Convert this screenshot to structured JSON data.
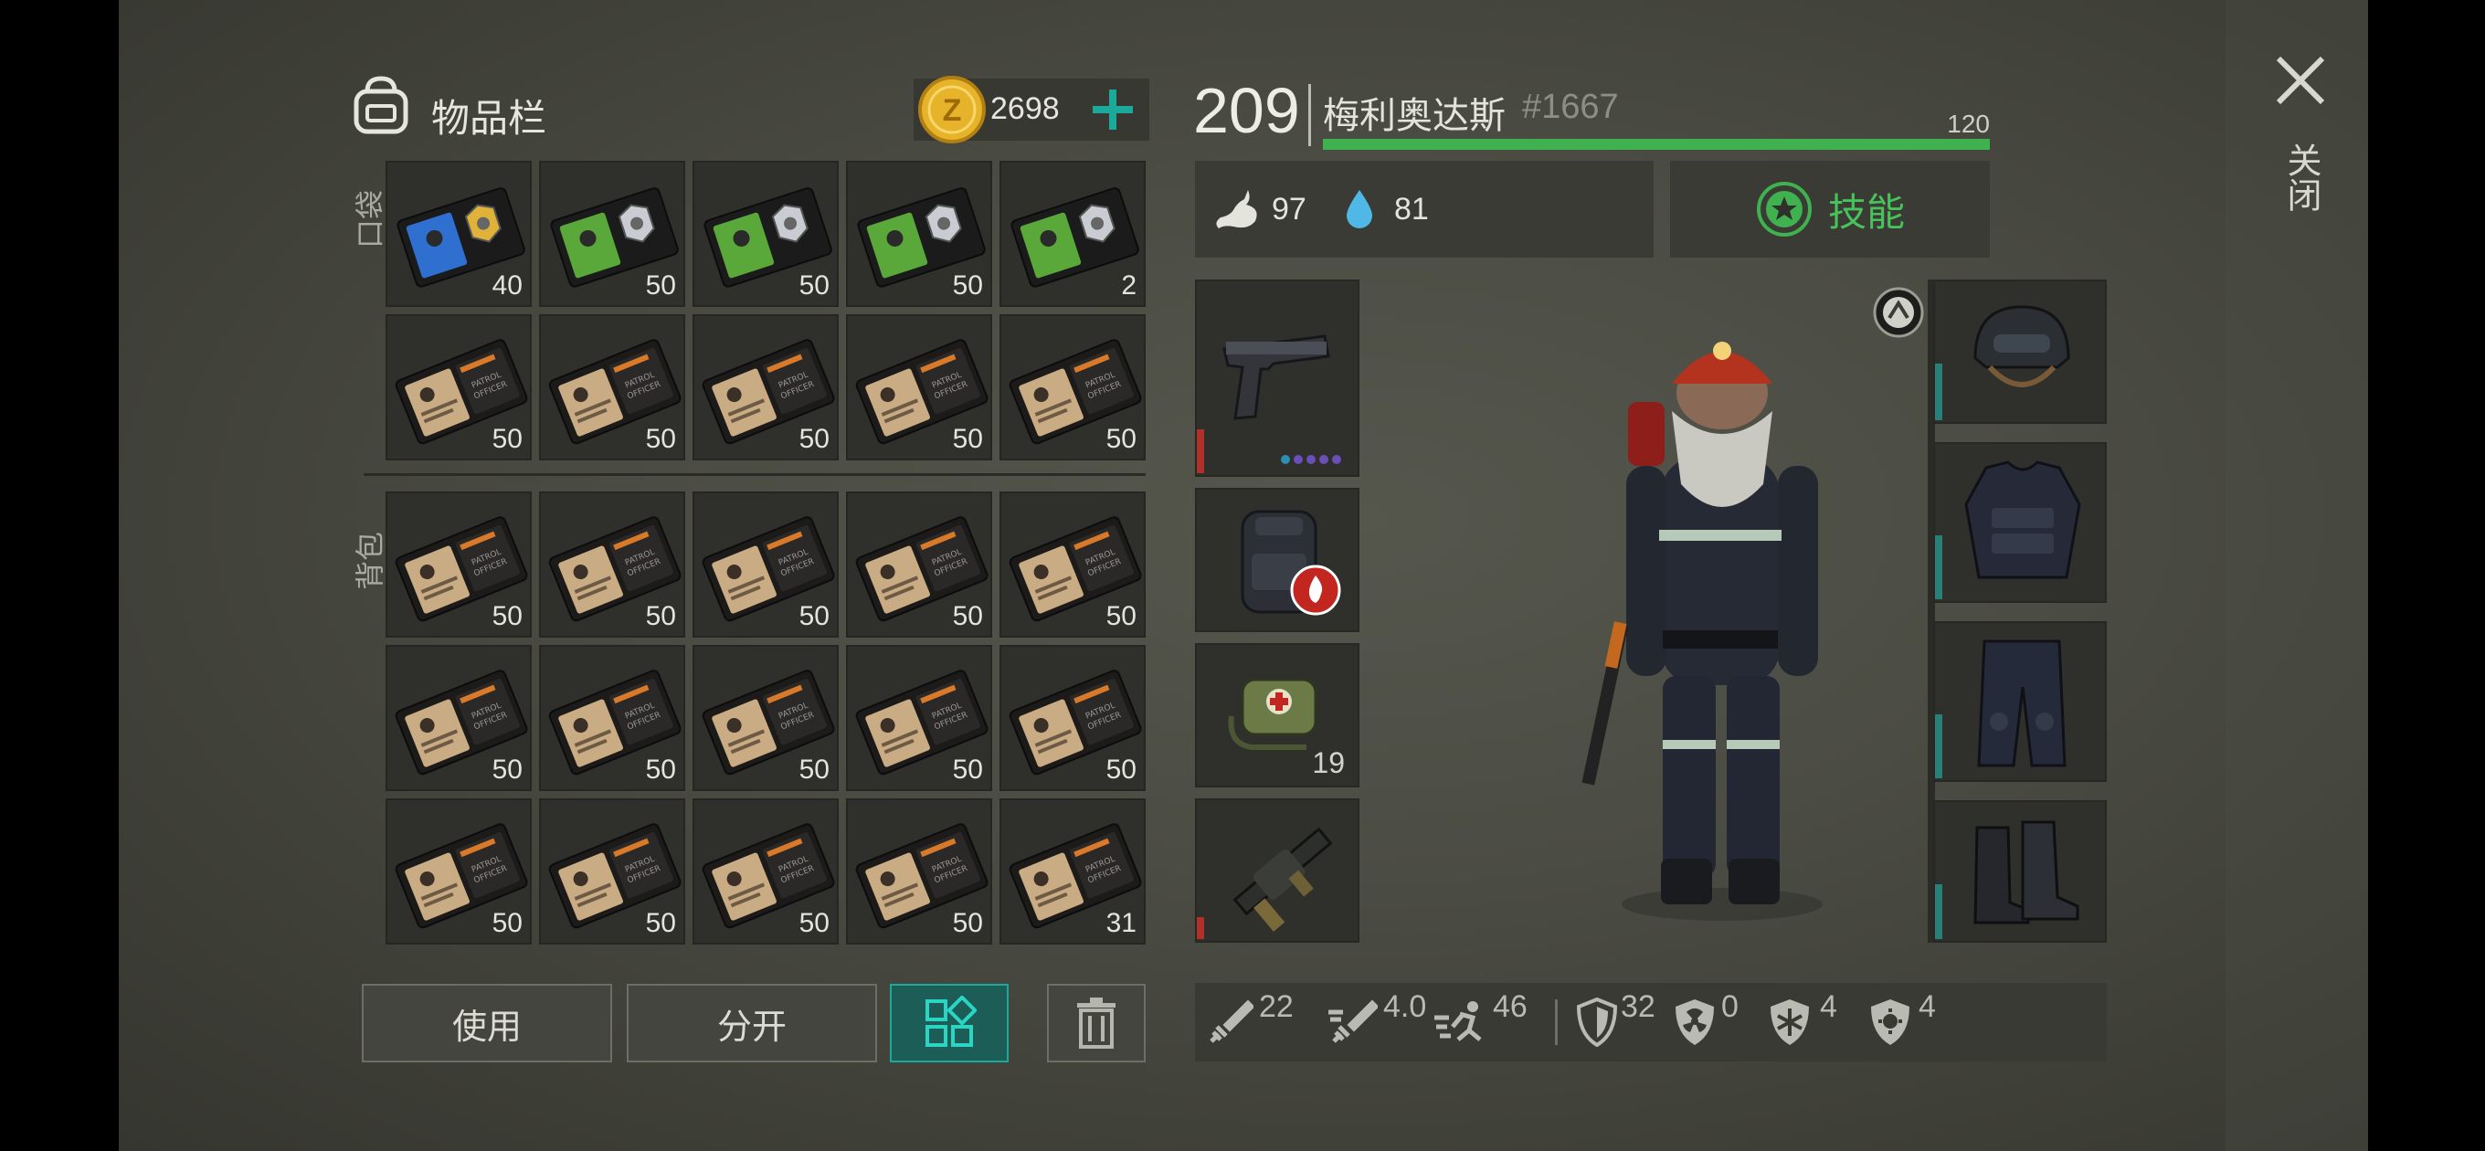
{
  "inventory": {
    "title": "物品栏",
    "coins": "2698",
    "pocket_label": "口袋",
    "backpack_label": "背包",
    "pocket_items": [
      {
        "icon": "police-badge-wallet-blue-icon",
        "count": "40"
      },
      {
        "icon": "police-badge-wallet-green-icon",
        "count": "50"
      },
      {
        "icon": "police-badge-wallet-green-icon",
        "count": "50"
      },
      {
        "icon": "police-badge-wallet-green-icon",
        "count": "50"
      },
      {
        "icon": "police-badge-wallet-green-icon",
        "count": "2"
      },
      {
        "icon": "patrol-officer-id-icon",
        "count": "50"
      },
      {
        "icon": "patrol-officer-id-icon",
        "count": "50"
      },
      {
        "icon": "patrol-officer-id-icon",
        "count": "50"
      },
      {
        "icon": "patrol-officer-id-icon",
        "count": "50"
      },
      {
        "icon": "patrol-officer-id-icon",
        "count": "50"
      }
    ],
    "backpack_items": [
      {
        "icon": "patrol-officer-id-icon",
        "count": "50"
      },
      {
        "icon": "patrol-officer-id-icon",
        "count": "50"
      },
      {
        "icon": "patrol-officer-id-icon",
        "count": "50"
      },
      {
        "icon": "patrol-officer-id-icon",
        "count": "50"
      },
      {
        "icon": "patrol-officer-id-icon",
        "count": "50"
      },
      {
        "icon": "patrol-officer-id-icon",
        "count": "50"
      },
      {
        "icon": "patrol-officer-id-icon",
        "count": "50"
      },
      {
        "icon": "patrol-officer-id-icon",
        "count": "50"
      },
      {
        "icon": "patrol-officer-id-icon",
        "count": "50"
      },
      {
        "icon": "patrol-officer-id-icon",
        "count": "50"
      },
      {
        "icon": "patrol-officer-id-icon",
        "count": "50"
      },
      {
        "icon": "patrol-officer-id-icon",
        "count": "50"
      },
      {
        "icon": "patrol-officer-id-icon",
        "count": "50"
      },
      {
        "icon": "patrol-officer-id-icon",
        "count": "50"
      },
      {
        "icon": "patrol-officer-id-icon",
        "count": "31"
      }
    ],
    "patrol_text": "PATROL OFFICER"
  },
  "actions": {
    "use": "使用",
    "split": "分开"
  },
  "character": {
    "level": "209",
    "name": "梅利奥达斯",
    "tag": "#1667",
    "hp": "120",
    "hp_fraction": 1.0,
    "food": "97",
    "water": "81",
    "skills_label": "技能",
    "consumable_count": "19",
    "pistol_mods": 5
  },
  "stats": {
    "melee": "22",
    "melee_speed": "4.0",
    "speed": "46",
    "armor": "32",
    "radiation": "0",
    "cold": "4",
    "virus": "4"
  },
  "close_label": "关闭",
  "colors": {
    "accent": "#3fb14f",
    "teal": "#1aa99a",
    "hp": "#3fb14f",
    "coin": "#e6b32a"
  }
}
